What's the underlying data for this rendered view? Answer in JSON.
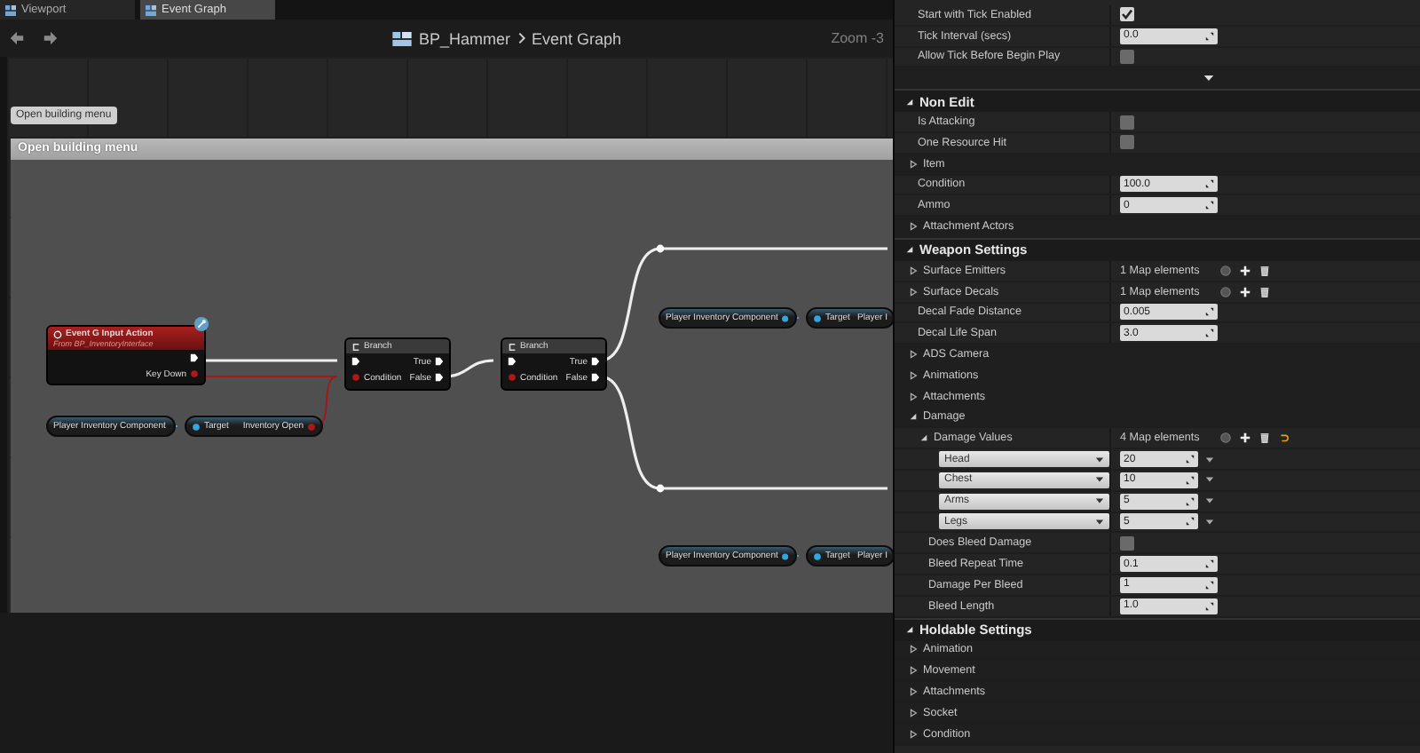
{
  "tabs": [
    {
      "label": "Viewport",
      "selected": false
    },
    {
      "label": "Event Graph",
      "selected": true
    }
  ],
  "breadcrumb": {
    "blueprint": "BP_Hammer",
    "graph": "Event Graph",
    "zoom": "Zoom -3"
  },
  "graph": {
    "tooltip": "Open building menu",
    "comment": "Open building menu",
    "nodes": [
      {
        "kind": "event",
        "title": "Event G Input Action",
        "subtitle": "From BP_InventoryInterface",
        "output": "Key Down"
      },
      {
        "kind": "variable",
        "label": "Player Inventory Component"
      },
      {
        "kind": "function",
        "input": "Target",
        "output": "Inventory Open"
      },
      {
        "kind": "branch",
        "title": "Branch",
        "condition": "Condition",
        "on_true": "True",
        "on_false": "False"
      },
      {
        "kind": "branch",
        "title": "Branch",
        "condition": "Condition",
        "on_true": "True",
        "on_false": "False"
      },
      {
        "kind": "variable",
        "label": "Player Inventory Component"
      },
      {
        "kind": "function",
        "input": "Target",
        "output": "Player I"
      },
      {
        "kind": "variable",
        "label": "Player Inventory Component"
      },
      {
        "kind": "function",
        "input": "Target",
        "output": "Player I"
      }
    ]
  },
  "details": {
    "sections": [
      {
        "rows": [
          {
            "kind": "checkbox",
            "label": "Start with Tick Enabled",
            "checked": true
          },
          {
            "kind": "number",
            "label": "Tick Interval (secs)",
            "value": "0.0"
          },
          {
            "kind": "checkbox",
            "label": "Allow Tick Before Begin Play",
            "checked": false
          },
          {
            "kind": "show_more"
          }
        ]
      },
      {
        "title": "Non Edit",
        "expanded": true,
        "rows": [
          {
            "kind": "checkbox",
            "label": "Is Attacking",
            "checked": false
          },
          {
            "kind": "checkbox",
            "label": "One Resource Hit",
            "checked": false
          },
          {
            "kind": "group",
            "label": "Item",
            "expanded": false
          },
          {
            "kind": "number",
            "label": "Condition",
            "value": "100.0"
          },
          {
            "kind": "number",
            "label": "Ammo",
            "value": "0"
          },
          {
            "kind": "group",
            "label": "Attachment Actors",
            "expanded": false
          }
        ]
      },
      {
        "title": "Weapon Settings",
        "expanded": true,
        "rows": [
          {
            "kind": "map",
            "label": "Surface Emitters",
            "count": "1 Map elements",
            "expanded": false,
            "modified": false
          },
          {
            "kind": "map",
            "label": "Surface Decals",
            "count": "1 Map elements",
            "expanded": false,
            "modified": false
          },
          {
            "kind": "number",
            "label": "Decal Fade Distance",
            "value": "0.005"
          },
          {
            "kind": "number",
            "label": "Decal Life Span",
            "value": "3.0"
          },
          {
            "kind": "group",
            "label": "ADS Camera",
            "expanded": false
          },
          {
            "kind": "group",
            "label": "Animations",
            "expanded": false
          },
          {
            "kind": "group",
            "label": "Attachments",
            "expanded": false
          },
          {
            "kind": "group",
            "label": "Damage",
            "expanded": true,
            "children": [
              {
                "kind": "map",
                "label": "Damage Values",
                "count": "4 Map elements",
                "expanded": true,
                "modified": true,
                "children": [
                  {
                    "kind": "map_entry",
                    "key": "Head",
                    "value": "20"
                  },
                  {
                    "kind": "map_entry",
                    "key": "Chest",
                    "value": "10"
                  },
                  {
                    "kind": "map_entry",
                    "key": "Arms",
                    "value": "5"
                  },
                  {
                    "kind": "map_entry",
                    "key": "Legs",
                    "value": "5"
                  }
                ]
              },
              {
                "kind": "checkbox",
                "label": "Does Bleed Damage",
                "checked": false
              },
              {
                "kind": "number",
                "label": "Bleed Repeat Time",
                "value": "0.1"
              },
              {
                "kind": "number",
                "label": "Damage Per Bleed",
                "value": "1"
              },
              {
                "kind": "number",
                "label": "Bleed Length",
                "value": "1.0"
              }
            ]
          }
        ]
      },
      {
        "title": "Holdable Settings",
        "expanded": true,
        "rows": [
          {
            "kind": "group",
            "label": "Animation",
            "expanded": false
          },
          {
            "kind": "group",
            "label": "Movement",
            "expanded": false
          },
          {
            "kind": "group",
            "label": "Attachments",
            "expanded": false
          },
          {
            "kind": "group",
            "label": "Socket",
            "expanded": false
          },
          {
            "kind": "group",
            "label": "Condition",
            "expanded": false
          }
        ]
      }
    ]
  }
}
